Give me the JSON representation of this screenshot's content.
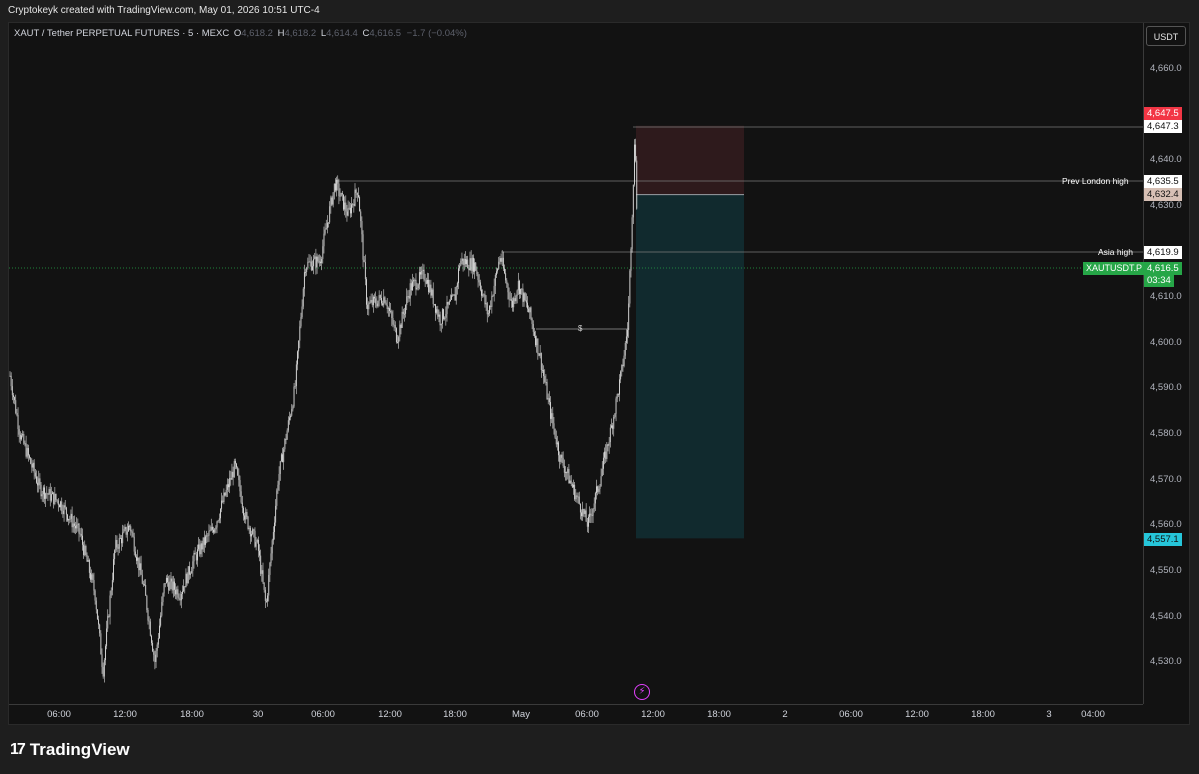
{
  "header": {
    "credit": "Cryptokeyk created with TradingView.com, May 01, 2026 10:51 UTC-4"
  },
  "legend": {
    "symbol": "XAUT / Tether PERPETUAL FUTURES · 5 · MEXC",
    "open_label": "O",
    "open": "4,618.2",
    "high_label": "H",
    "high": "4,618.2",
    "low_label": "L",
    "low": "4,614.4",
    "close": "4,616.5",
    "change": "−1.7 (−0.04%)"
  },
  "price_axis": {
    "unit": "USDT",
    "ticks": [
      "4,660.0",
      "4,640.0",
      "4,630.0",
      "4,610.0",
      "4,600.0",
      "4,590.0",
      "4,580.0",
      "4,570.0",
      "4,560.0",
      "4,550.0",
      "4,540.0",
      "4,530.0"
    ],
    "badges": {
      "stop": "4,647.5",
      "high_line": "4,647.3",
      "london": "4,635.5",
      "entry": "4,632.4",
      "asia": "4,619.9",
      "last_price": "4,616.5",
      "countdown": "03:34",
      "target": "4,557.1"
    }
  },
  "time_axis": {
    "ticks": [
      "06:00",
      "12:00",
      "18:00",
      "30",
      "06:00",
      "12:00",
      "18:00",
      "May",
      "06:00",
      "12:00",
      "18:00",
      "2",
      "06:00",
      "12:00",
      "18:00",
      "3",
      "04:00"
    ]
  },
  "annotations": {
    "prev_london_high": "Prev London high",
    "asia_high": "Asia high",
    "symbol_tag": "XAUTUSDT.P",
    "dollar_mark": "$"
  },
  "position": {
    "type": "short",
    "entry": 4632.4,
    "stop": 4647.5,
    "target": 4557.1
  },
  "colors": {
    "background": "#121212",
    "candle": "#d9d9d9",
    "stop_zone": "#2e1a1c",
    "target_zone": "#112a2e",
    "stop_badge": "#f23645",
    "target_badge": "#26c6da",
    "last_price": "#26a647",
    "entry_badge": "#d7c0b5"
  },
  "footer": {
    "brand": "TradingView",
    "flash_icon": "lightning-icon"
  }
}
